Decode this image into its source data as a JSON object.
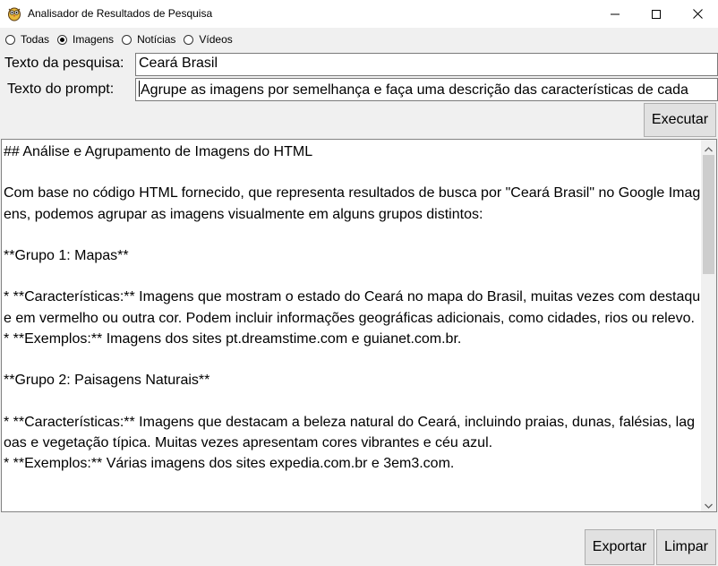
{
  "window": {
    "title": "Analisador de Resultados de Pesquisa",
    "icon": "owl-app-icon",
    "controls": [
      "minimize-icon",
      "maximize-icon",
      "close-icon"
    ]
  },
  "search_type": {
    "options": [
      "Todas",
      "Imagens",
      "Notícias",
      "Vídeos"
    ],
    "selected": "Imagens"
  },
  "search": {
    "label": "Texto da pesquisa:",
    "value": "Ceará Brasil"
  },
  "prompt": {
    "label": "Texto do prompt:",
    "value": "Agrupe as imagens por semelhança e faça uma descrição das características de cada"
  },
  "buttons": {
    "execute": "Executar",
    "export": "Exportar",
    "clear": "Limpar"
  },
  "output": {
    "text": "## Análise e Agrupamento de Imagens do HTML\n\nCom base no código HTML fornecido, que representa resultados de busca por \"Ceará Brasil\" no Google Imagens, podemos agrupar as imagens visualmente em alguns grupos distintos:\n\n**Grupo 1: Mapas**\n\n* **Características:** Imagens que mostram o estado do Ceará no mapa do Brasil, muitas vezes com destaque em vermelho ou outra cor. Podem incluir informações geográficas adicionais, como cidades, rios ou relevo.\n* **Exemplos:** Imagens dos sites pt.dreamstime.com e guianet.com.br.\n\n**Grupo 2: Paisagens Naturais**\n\n* **Características:** Imagens que destacam a beleza natural do Ceará, incluindo praias, dunas, falésias, lagoas e vegetação típica. Muitas vezes apresentam cores vibrantes e céu azul.\n* **Exemplos:** Várias imagens dos sites expedia.com.br e 3em3.com."
  },
  "colors": {
    "window_bg": "#f0f0f0",
    "titlebar_bg": "#ffffff",
    "button_bg": "#e1e1e1",
    "scroll_thumb": "#cdcdcd"
  }
}
